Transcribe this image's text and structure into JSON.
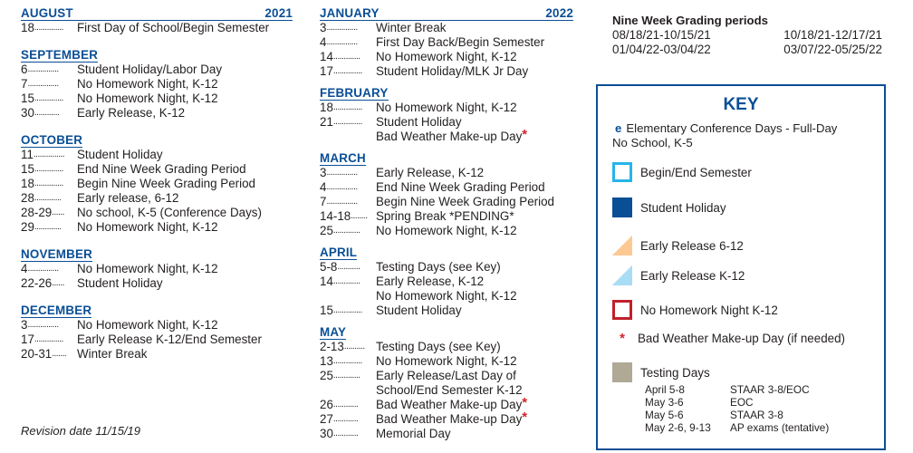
{
  "calendar": {
    "col1": {
      "year": "2021",
      "months": [
        {
          "name": "AUGUST",
          "events": [
            {
              "date": "18",
              "dots": "..............",
              "text": "First Day of School/Begin Semester"
            }
          ]
        },
        {
          "name": "SEPTEMBER",
          "events": [
            {
              "date": "6",
              "dots": "...............",
              "text": "Student Holiday/Labor Day"
            },
            {
              "date": "7",
              "dots": "...............",
              "text": "No Homework Night, K-12"
            },
            {
              "date": "15",
              "dots": "..............",
              "text": "No Homework Night, K-12"
            },
            {
              "date": "30",
              "dots": "............",
              "text": "Early Release, K-12"
            }
          ]
        },
        {
          "name": "OCTOBER",
          "events": [
            {
              "date": "11",
              "dots": "...............",
              "text": "Student Holiday"
            },
            {
              "date": "15",
              "dots": "..............",
              "text": "End Nine Week Grading Period"
            },
            {
              "date": "18",
              "dots": "..............",
              "text": "Begin Nine Week Grading Period"
            },
            {
              "date": "28",
              "dots": ".............",
              "text": "Early release, 6-12"
            },
            {
              "date": "28-29",
              "dots": "......",
              "text": "No school, K-5 (Conference Days)"
            },
            {
              "date": "29",
              "dots": ".............",
              "text": "No Homework Night, K-12"
            }
          ]
        },
        {
          "name": "NOVEMBER",
          "events": [
            {
              "date": "4",
              "dots": "...............",
              "text": "No Homework Night, K-12"
            },
            {
              "date": "22-26",
              "dots": "......",
              "text": "Student Holiday"
            }
          ]
        },
        {
          "name": "DECEMBER",
          "events": [
            {
              "date": "3",
              "dots": "...............",
              "text": "No Homework Night, K-12"
            },
            {
              "date": "17",
              "dots": "..............",
              "text": "Early Release K-12/End Semester"
            },
            {
              "date": "20-31",
              "dots": ".......",
              "text": "Winter Break"
            }
          ]
        }
      ]
    },
    "col2": {
      "year": "2022",
      "months": [
        {
          "name": "JANUARY",
          "events": [
            {
              "date": "3",
              "dots": "...............",
              "text": "Winter Break"
            },
            {
              "date": "4",
              "dots": "...............",
              "text": "First Day Back/Begin Semester"
            },
            {
              "date": "14",
              "dots": ".............",
              "text": "No Homework Night, K-12"
            },
            {
              "date": "17",
              "dots": "..............",
              "text": "Student Holiday/MLK Jr Day"
            }
          ]
        },
        {
          "name": "FEBRUARY",
          "events": [
            {
              "date": "18",
              "dots": "..............",
              "text": "No Homework Night, K-12"
            },
            {
              "date": "21",
              "dots": "..............",
              "text": "Student Holiday"
            },
            {
              "date": "",
              "dots": "",
              "text": "Bad Weather Make-up Day",
              "star": "*"
            }
          ]
        },
        {
          "name": "MARCH",
          "events": [
            {
              "date": "3",
              "dots": "...............",
              "text": "Early Release, K-12"
            },
            {
              "date": "4",
              "dots": "...............",
              "text": "End Nine Week Grading Period"
            },
            {
              "date": "7",
              "dots": "...............",
              "text": "Begin Nine Week Grading Period"
            },
            {
              "date": "14-18",
              "dots": "........",
              "text": "Spring Break *PENDING*"
            },
            {
              "date": "25",
              "dots": ".............",
              "text": "No Homework Night, K-12"
            }
          ]
        },
        {
          "name": "APRIL",
          "events": [
            {
              "date": "5-8",
              "dots": "...........",
              "text": "Testing Days (see Key)"
            },
            {
              "date": "14",
              "dots": ".............",
              "text": "Early Release, K-12"
            },
            {
              "date": "",
              "dots": "",
              "text": "No Homework Night, K-12"
            },
            {
              "date": "15",
              "dots": "..............",
              "text": "Student Holiday"
            }
          ]
        },
        {
          "name": "MAY",
          "events": [
            {
              "date": "2-13",
              "dots": "..........",
              "text": "Testing Days (see Key)"
            },
            {
              "date": "13",
              "dots": "..............",
              "text": "No Homework Night, K-12"
            },
            {
              "date": "25",
              "dots": ".............",
              "text": "Early Release/Last Day of"
            },
            {
              "date": "",
              "dots": "",
              "text": "School/End Semester K-12"
            },
            {
              "date": "26",
              "dots": "............",
              "text": "Bad Weather Make-up Day",
              "star": "*"
            },
            {
              "date": "27",
              "dots": "............",
              "text": "Bad Weather Make-up Day",
              "star": "*"
            },
            {
              "date": "30",
              "dots": "............",
              "text": "Memorial Day"
            }
          ]
        }
      ]
    }
  },
  "revision": "Revision date 11/15/19",
  "grading": {
    "title": "Nine Week Grading periods",
    "periods": [
      [
        "08/18/21-10/15/21",
        "10/18/21-12/17/21"
      ],
      [
        "01/04/22-03/04/22",
        "03/07/22-05/25/22"
      ]
    ]
  },
  "key": {
    "title": "KEY",
    "conference": {
      "marker": "e",
      "text": "Elementary Conference Days - Full-Day",
      "text2": "No School, K-5"
    },
    "items": [
      {
        "label": "Begin/End Semester",
        "color": "#26b4ea"
      },
      {
        "label": "Student Holiday",
        "color": "#0a4e96"
      },
      {
        "label": "Early Release 6-12",
        "color": "#fcc994"
      },
      {
        "label": "Early Release K-12",
        "color": "#a9ddf5"
      },
      {
        "label": "No Homework Night K-12",
        "color": "#c0202b"
      },
      {
        "label": "Bad Weather Make-up Day (if needed)",
        "marker": "*",
        "color": "#d2232a"
      },
      {
        "label": "Testing Days",
        "color": "#b0a996"
      }
    ],
    "tests": [
      {
        "when": "April 5-8",
        "what": "STAAR 3-8/EOC"
      },
      {
        "when": "May 3-6",
        "what": "EOC"
      },
      {
        "when": "May 5-6",
        "what": "STAAR 3-8"
      },
      {
        "when": "May 2-6, 9-13",
        "what": "AP exams (tentative)"
      }
    ]
  }
}
